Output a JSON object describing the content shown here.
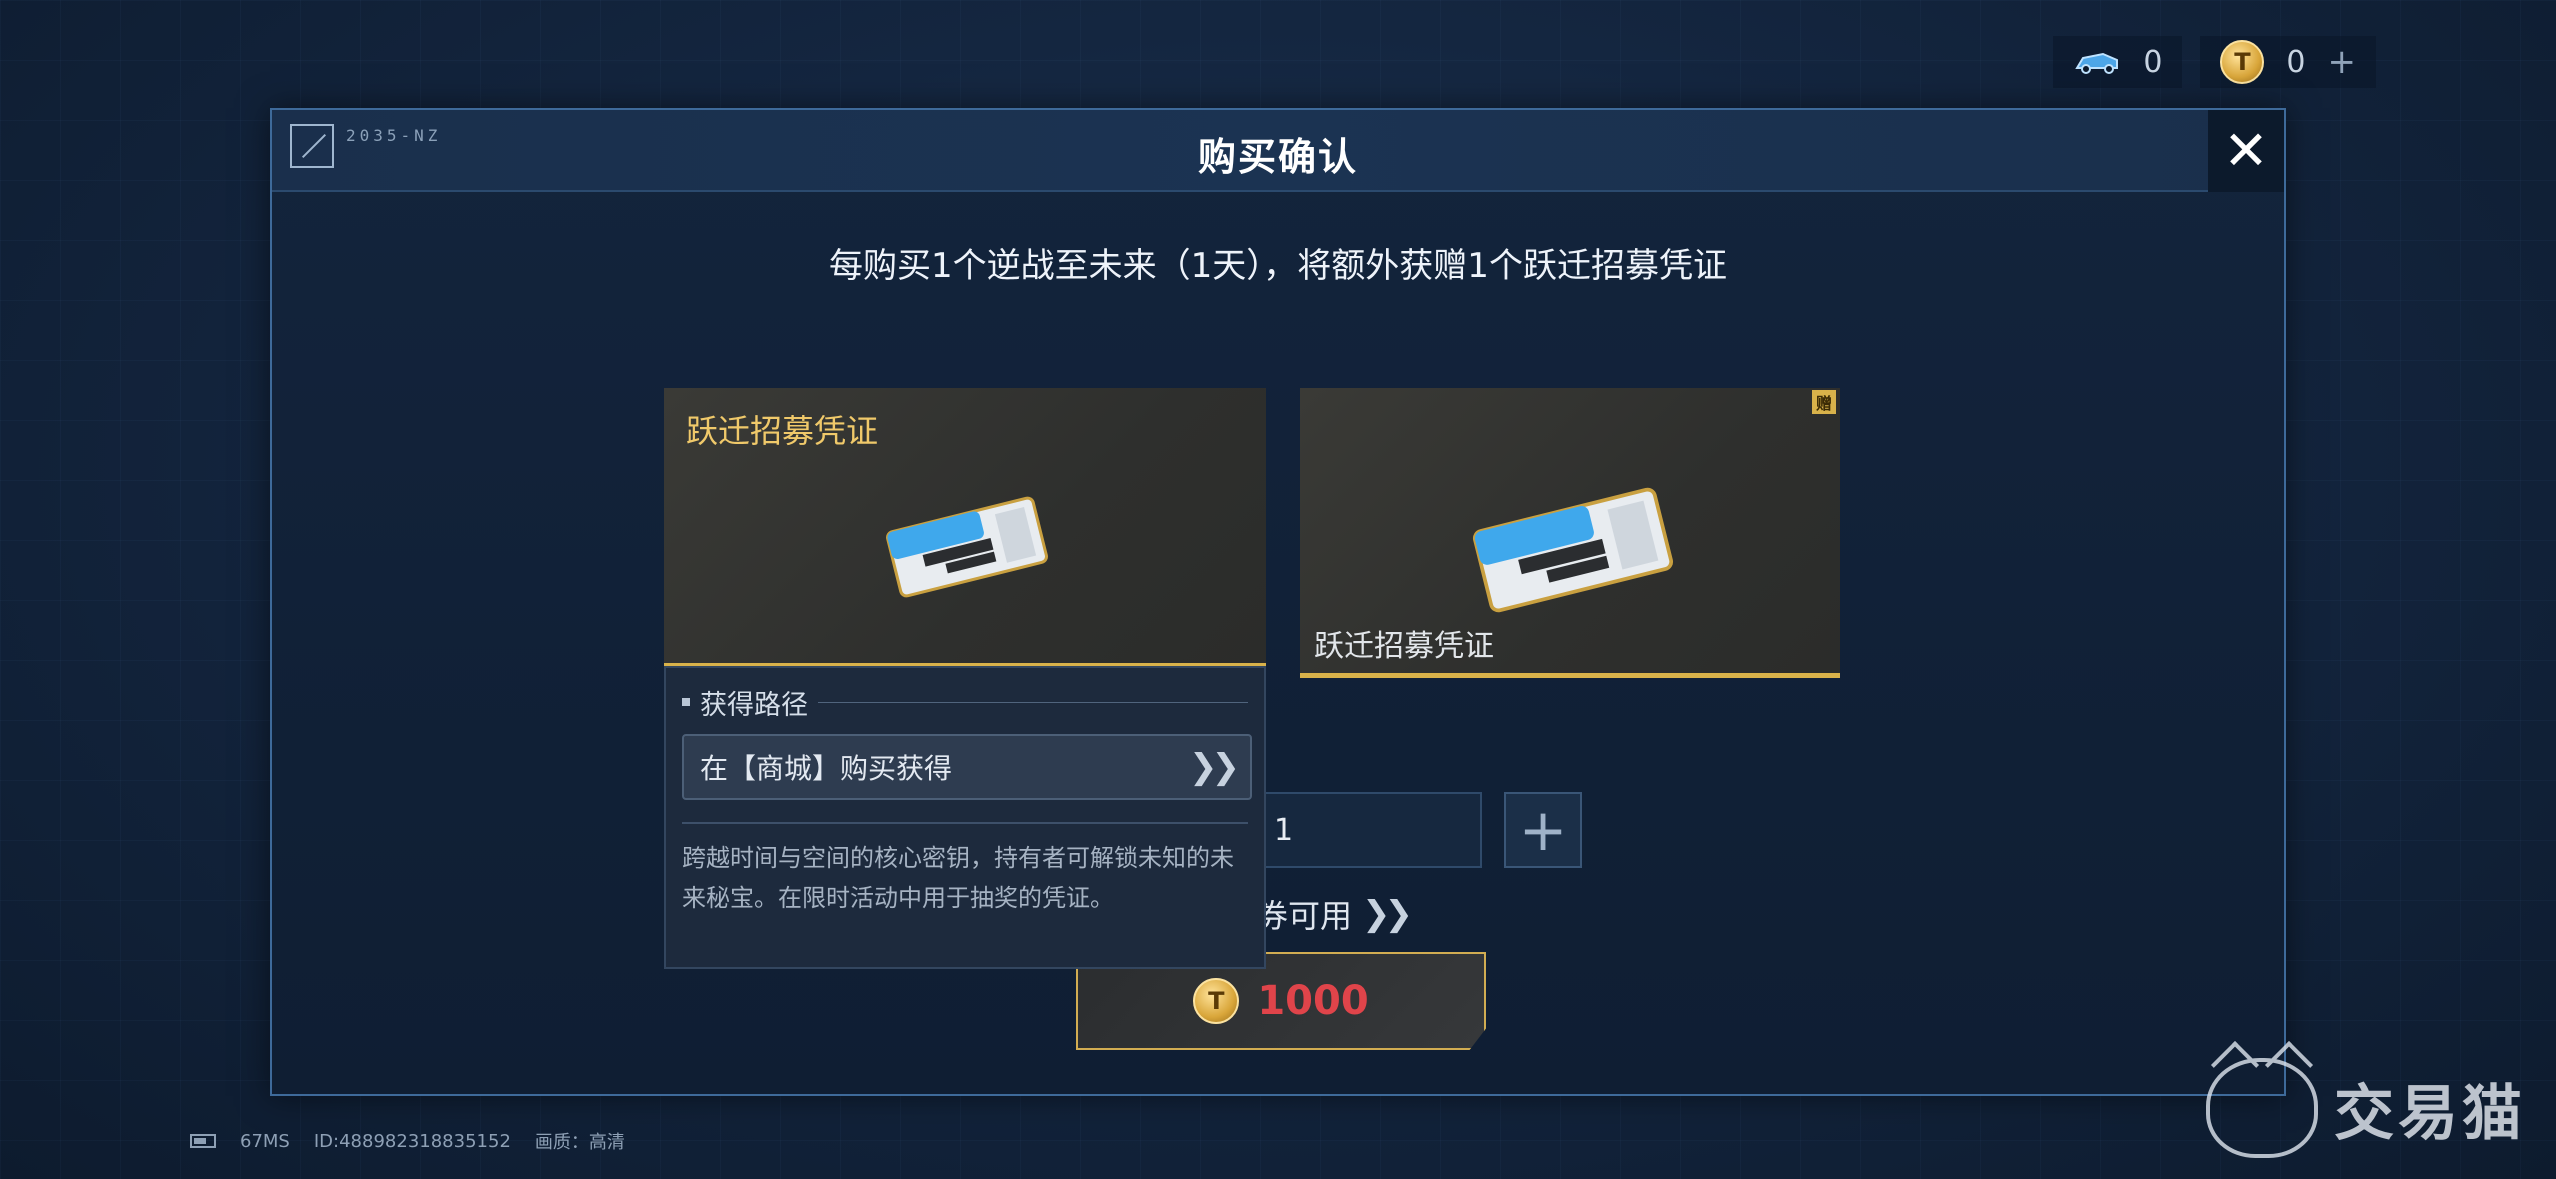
{
  "currency": {
    "vehicle_value": "0",
    "coin_value": "0",
    "add_label": "+"
  },
  "modal": {
    "header_code": "2035-NZ",
    "title": "购买确认",
    "close_label": "✕",
    "notice": "每购买1个逆战至未来（1天），将额外获赠1个跃迁招募凭证"
  },
  "item_card": {
    "name": "跃迁招募凭证"
  },
  "gift_card": {
    "name": "跃迁招募凭证",
    "badge": "赠"
  },
  "tooltip": {
    "heading": "获得路径",
    "route_label": "在【商城】购买获得",
    "description": "跨越时间与空间的核心密钥，持有者可解锁未知的未来秘宝。在限时活动中用于抽奖的凭证。"
  },
  "quantity": {
    "value": "1",
    "plus_label": "+"
  },
  "voucher": {
    "text": "购物券可用"
  },
  "buy": {
    "price": "1000"
  },
  "footer": {
    "ping": "67MS",
    "id": "ID:488982318835152",
    "quality": "画质：高清"
  },
  "watermark": {
    "text": "交易猫"
  },
  "colors": {
    "accent_gold": "#d9b24a",
    "price_red": "#e0444a",
    "item_name_gold": "#f0c96a"
  }
}
